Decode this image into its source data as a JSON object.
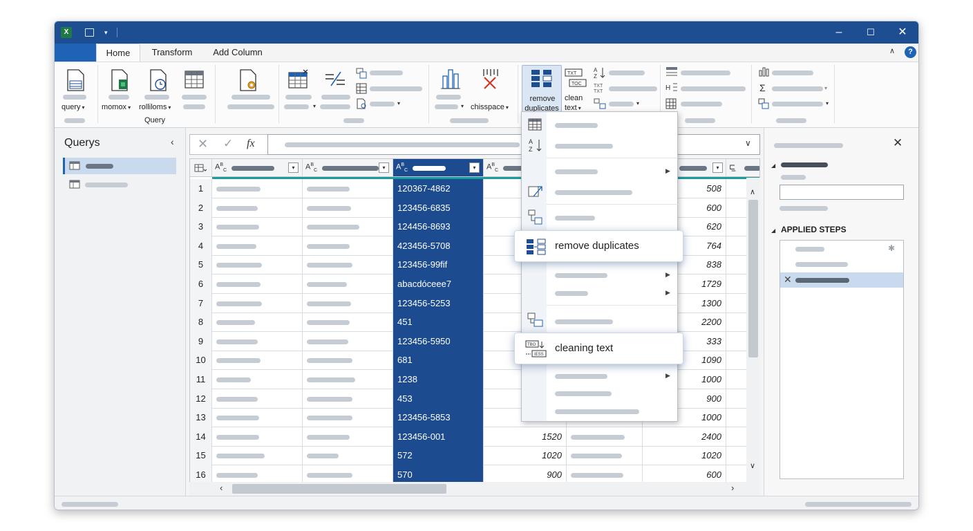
{
  "ribbon_tabs": [
    {
      "label": "Home"
    },
    {
      "label": "Transform"
    },
    {
      "label": "Add Column"
    }
  ],
  "ribbon": {
    "query_label": "query",
    "momox_label": "momox",
    "rollilons_label": "rolliloms",
    "group_query": "Query",
    "chisspace_label": "chisspace",
    "remove_dup_line1": "remove",
    "remove_dup_line2": "duplicates",
    "clean_line1": "clean",
    "clean_line2": "text"
  },
  "queries_panel": {
    "title": "Querys"
  },
  "formula_bar": {
    "fx": "fx"
  },
  "grid": {
    "rows": [
      {
        "n": "1",
        "id": "120367-4862",
        "v": "508"
      },
      {
        "n": "2",
        "id": "123456-6835",
        "v": "600"
      },
      {
        "n": "3",
        "id": "124456-8693",
        "v": "620"
      },
      {
        "n": "4",
        "id": "423456-5708",
        "v": "764"
      },
      {
        "n": "5",
        "id": "123456-99fif",
        "v": "838"
      },
      {
        "n": "6",
        "id": "abacdóceee7",
        "v": "1729"
      },
      {
        "n": "7",
        "id": "123456-5253",
        "v": "1300"
      },
      {
        "n": "8",
        "id": "451",
        "v": "2200"
      },
      {
        "n": "9",
        "id": "123456-5950",
        "v": "333"
      },
      {
        "n": "10",
        "id": "681",
        "v": "1090"
      },
      {
        "n": "11",
        "id": "1238",
        "v": "1000"
      },
      {
        "n": "12",
        "id": "453",
        "v": "900"
      },
      {
        "n": "13",
        "id": "123456-5853",
        "v": "1000"
      },
      {
        "n": "14",
        "id": "123456-001",
        "mid": "1520",
        "v": "2400"
      },
      {
        "n": "15",
        "id": "572",
        "mid": "1020",
        "v": "1020"
      },
      {
        "n": "16",
        "id": "570",
        "mid": "900",
        "v": "600"
      }
    ]
  },
  "context_menu": {
    "remove_duplicates": "remove duplicates",
    "cleaning_text": "cleaning text"
  },
  "settings": {
    "applied_steps": "APPLIED STEPS"
  },
  "colors": {
    "title_bar": "#1e4e92",
    "selected_column": "#1c4b8f",
    "accent_line": "#1a9c9c"
  }
}
